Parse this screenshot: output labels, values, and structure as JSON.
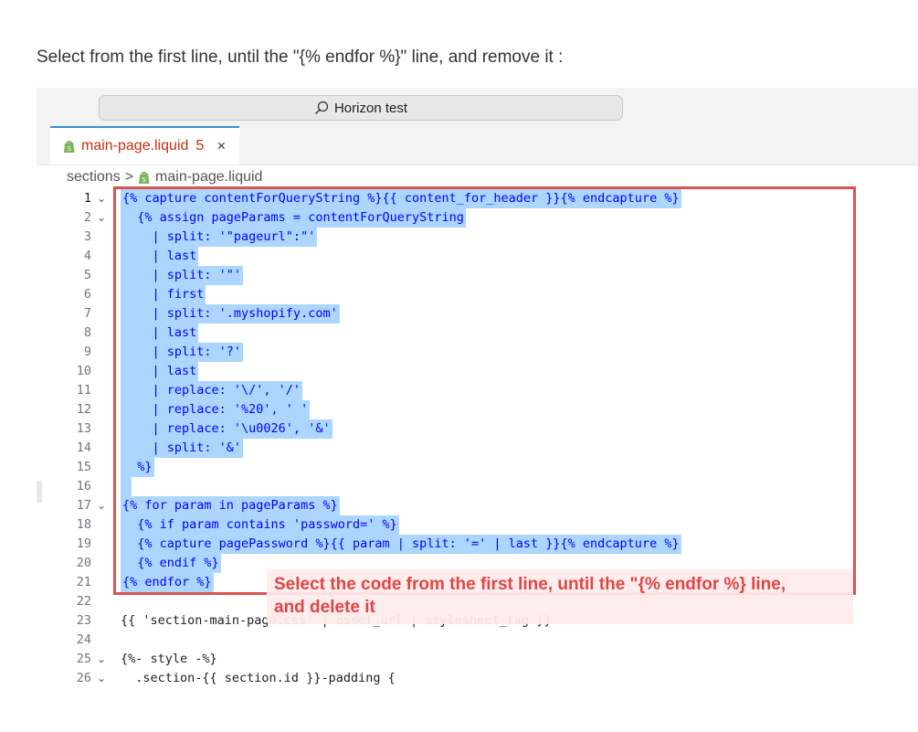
{
  "instruction": "Select from the first line, until the \"{% endfor %}\" line, and remove it :",
  "window": {
    "search_label": "Horizon test"
  },
  "tab": {
    "file_name": "main-page.liquid",
    "problem_count": "5",
    "close_glyph": "×"
  },
  "breadcrumbs": {
    "folder": "sections",
    "separator": ">",
    "file": "main-page.liquid"
  },
  "code_lines": [
    {
      "n": "1",
      "text": "{% capture contentForQueryString %}{{ content_for_header }}{% endcapture %}",
      "fold": "⌄",
      "selected": true
    },
    {
      "n": "2",
      "text": "  {% assign pageParams = contentForQueryString",
      "fold": "⌄",
      "selected": true
    },
    {
      "n": "3",
      "text": "    | split: '\"pageurl\":\"'",
      "fold": "",
      "selected": true
    },
    {
      "n": "4",
      "text": "    | last",
      "fold": "",
      "selected": true
    },
    {
      "n": "5",
      "text": "    | split: '\"'",
      "fold": "",
      "selected": true
    },
    {
      "n": "6",
      "text": "    | first",
      "fold": "",
      "selected": true
    },
    {
      "n": "7",
      "text": "    | split: '.myshopify.com'",
      "fold": "",
      "selected": true
    },
    {
      "n": "8",
      "text": "    | last",
      "fold": "",
      "selected": true
    },
    {
      "n": "9",
      "text": "    | split: '?'",
      "fold": "",
      "selected": true
    },
    {
      "n": "10",
      "text": "    | last",
      "fold": "",
      "selected": true
    },
    {
      "n": "11",
      "text": "    | replace: '\\/', '/'",
      "fold": "",
      "selected": true
    },
    {
      "n": "12",
      "text": "    | replace: '%20', ' '",
      "fold": "",
      "selected": true
    },
    {
      "n": "13",
      "text": "    | replace: '\\u0026', '&'",
      "fold": "",
      "selected": true
    },
    {
      "n": "14",
      "text": "    | split: '&'",
      "fold": "",
      "selected": true
    },
    {
      "n": "15",
      "text": "  %}",
      "fold": "",
      "selected": true
    },
    {
      "n": "16",
      "text": " ",
      "fold": "",
      "selected": true
    },
    {
      "n": "17",
      "text": "{% for param in pageParams %}",
      "fold": "⌄",
      "selected": true
    },
    {
      "n": "18",
      "text": "  {% if param contains 'password=' %}",
      "fold": "",
      "selected": true
    },
    {
      "n": "19",
      "text": "  {% capture pagePassword %}{{ param | split: '=' | last }}{% endcapture %}",
      "fold": "",
      "selected": true
    },
    {
      "n": "20",
      "text": "  {% endif %}",
      "fold": "",
      "selected": true
    },
    {
      "n": "21",
      "text": "{% endfor %}",
      "fold": "",
      "selected": true
    },
    {
      "n": "22",
      "text": "",
      "fold": "",
      "selected": false
    },
    {
      "n": "23",
      "text": "{{ 'section-main-page.css' | asset_url | stylesheet_tag }}",
      "fold": "",
      "selected": false
    },
    {
      "n": "24",
      "text": "",
      "fold": "",
      "selected": false
    },
    {
      "n": "25",
      "text": "{%- style -%}",
      "fold": "⌄",
      "selected": false
    },
    {
      "n": "26",
      "text": "  .section-{{ section.id }}-padding {",
      "fold": "⌄",
      "selected": false
    }
  ],
  "annotation": {
    "line1": "Select the code from the first line, until the \"{% endfor %} line,",
    "line2": "and delete it"
  },
  "colors": {
    "selection": "#add6ff",
    "annotation_border": "#d9534f",
    "annotation_text": "#e04545",
    "keyword": "#0000ff"
  }
}
